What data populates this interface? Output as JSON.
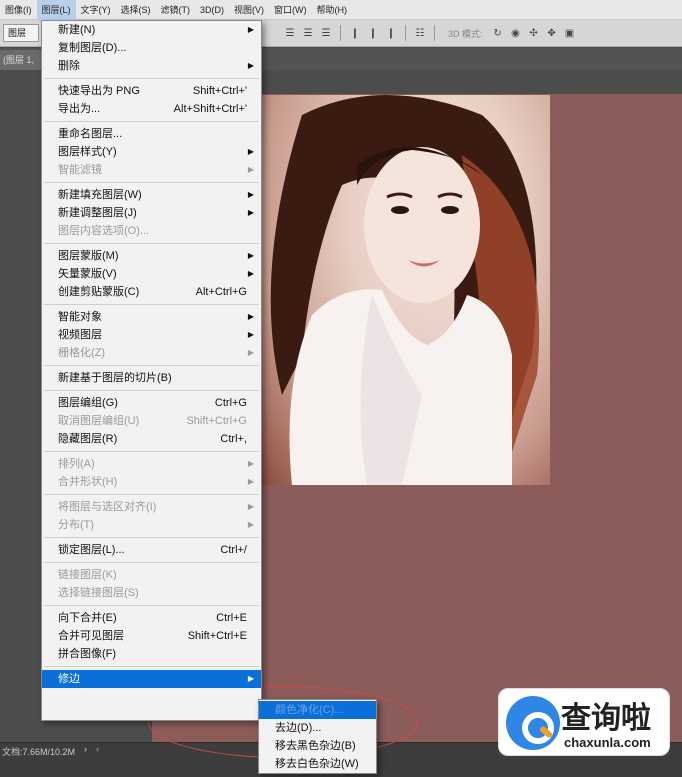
{
  "menubar": {
    "items": [
      "图像(I)",
      "图层(L)",
      "文字(Y)",
      "选择(S)",
      "滤镜(T)",
      "3D(D)",
      "视图(V)",
      "窗口(W)",
      "帮助(H)"
    ],
    "active_index": 1
  },
  "options_bar": {
    "select_value": "图层",
    "mode_3d_label": "3D 模式:"
  },
  "tabbar": {
    "doc_tab_label": "(图层 1,"
  },
  "layer_menu": {
    "items": [
      {
        "label": "新建(N)",
        "submenu": true
      },
      {
        "label": "复制图层(D)..."
      },
      {
        "label": "删除",
        "submenu": true
      },
      {
        "separator": true
      },
      {
        "label": "快速导出为 PNG",
        "shortcut": "Shift+Ctrl+'"
      },
      {
        "label": "导出为...",
        "shortcut": "Alt+Shift+Ctrl+'"
      },
      {
        "separator": true
      },
      {
        "label": "重命名图层..."
      },
      {
        "label": "图层样式(Y)",
        "submenu": true
      },
      {
        "label": "智能滤镜",
        "submenu": true,
        "disabled": true
      },
      {
        "separator": true
      },
      {
        "label": "新建填充图层(W)",
        "submenu": true
      },
      {
        "label": "新建调整图层(J)",
        "submenu": true
      },
      {
        "label": "图层内容选项(O)...",
        "disabled": true
      },
      {
        "separator": true
      },
      {
        "label": "图层蒙版(M)",
        "submenu": true
      },
      {
        "label": "矢量蒙版(V)",
        "submenu": true
      },
      {
        "label": "创建剪贴蒙版(C)",
        "shortcut": "Alt+Ctrl+G"
      },
      {
        "separator": true
      },
      {
        "label": "智能对象",
        "submenu": true
      },
      {
        "label": "视频图层",
        "submenu": true
      },
      {
        "label": "栅格化(Z)",
        "submenu": true,
        "disabled": true
      },
      {
        "separator": true
      },
      {
        "label": "新建基于图层的切片(B)"
      },
      {
        "separator": true
      },
      {
        "label": "图层编组(G)",
        "shortcut": "Ctrl+G"
      },
      {
        "label": "取消图层编组(U)",
        "shortcut": "Shift+Ctrl+G",
        "disabled": true
      },
      {
        "label": "隐藏图层(R)",
        "shortcut": "Ctrl+,"
      },
      {
        "separator": true
      },
      {
        "label": "排列(A)",
        "submenu": true,
        "disabled": true
      },
      {
        "label": "合并形状(H)",
        "submenu": true,
        "disabled": true
      },
      {
        "separator": true
      },
      {
        "label": "将图层与选区对齐(I)",
        "submenu": true,
        "disabled": true
      },
      {
        "label": "分布(T)",
        "submenu": true,
        "disabled": true
      },
      {
        "separator": true
      },
      {
        "label": "锁定图层(L)...",
        "shortcut": "Ctrl+/"
      },
      {
        "separator": true
      },
      {
        "label": "链接图层(K)",
        "disabled": true
      },
      {
        "label": "选择链接图层(S)",
        "disabled": true
      },
      {
        "separator": true
      },
      {
        "label": "向下合并(E)",
        "shortcut": "Ctrl+E"
      },
      {
        "label": "合并可见图层",
        "shortcut": "Shift+Ctrl+E"
      },
      {
        "label": "拼合图像(F)"
      },
      {
        "separator": true
      },
      {
        "label": "修边",
        "submenu": true,
        "highlight": true
      }
    ]
  },
  "matting_submenu": {
    "items": [
      {
        "label": "颜色净化(C)...",
        "highlight": true
      },
      {
        "label": "去边(D)..."
      },
      {
        "label": "移去黑色杂边(B)"
      },
      {
        "label": "移去白色杂边(W)"
      }
    ]
  },
  "statusbar": {
    "doc_size": "文档:7.66M/10.2M"
  },
  "watermark": {
    "title": "查询啦",
    "url": "chaxunla.com"
  },
  "colors": {
    "canvas_bg": "#8c5c5b",
    "menu_highlight": "#0a6fd8",
    "annotation": "#d04a4a",
    "watermark_brand": "#2e86e6"
  }
}
